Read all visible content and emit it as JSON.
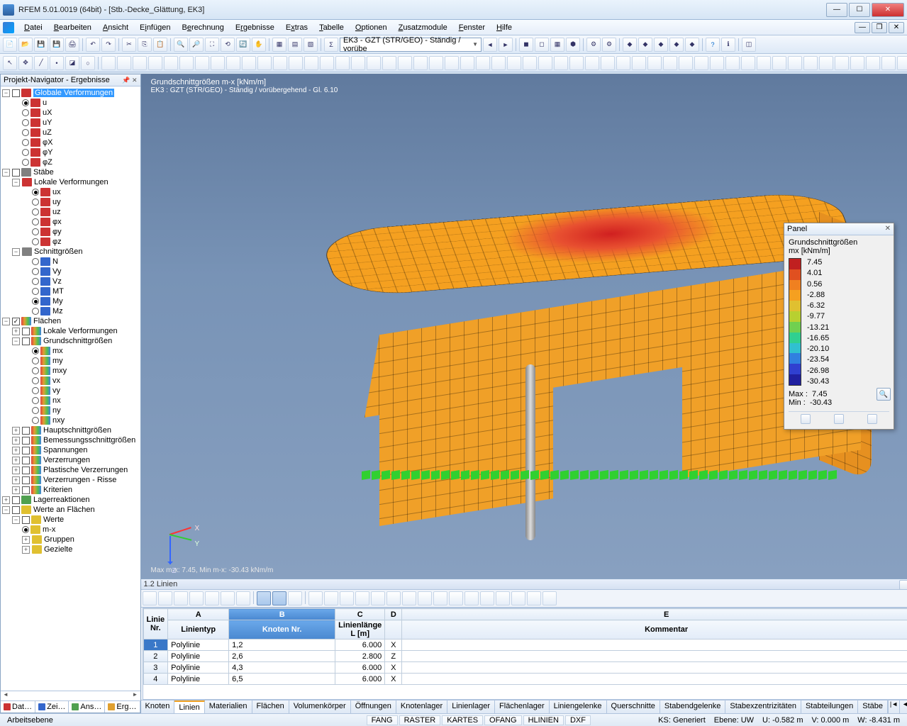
{
  "window": {
    "title": "RFEM 5.01.0019 (64bit) - [Stb.-Decke_Glättung, EK3]"
  },
  "menu": [
    "Datei",
    "Bearbeiten",
    "Ansicht",
    "Einfügen",
    "Berechnung",
    "Ergebnisse",
    "Extras",
    "Tabelle",
    "Optionen",
    "Zusatzmodule",
    "Fenster",
    "Hilfe"
  ],
  "menu_keys": [
    "D",
    "B",
    "A",
    "i",
    "e",
    "r",
    "x",
    "T",
    "O",
    "Z",
    "F",
    "H"
  ],
  "loadcase_combo": "EK3 - GZT (STR/GEO) - Ständig / vorübe",
  "nav": {
    "title": "Projekt-Navigator - Ergebnisse",
    "globale": {
      "label": "Globale Verformungen",
      "items": [
        "u",
        "uX",
        "uY",
        "uZ",
        "φX",
        "φY",
        "φZ"
      ],
      "sel_index": 0
    },
    "staebe": {
      "label": "Stäbe",
      "lokale": {
        "label": "Lokale Verformungen",
        "items": [
          "ux",
          "uy",
          "uz",
          "φx",
          "φy",
          "φz"
        ],
        "sel_index": 0
      },
      "schnitt": {
        "label": "Schnittgrößen",
        "items": [
          "N",
          "Vy",
          "Vz",
          "MT",
          "My",
          "Mz"
        ],
        "sel_index": 4
      }
    },
    "flaechen": {
      "label": "Flächen",
      "lokale": "Lokale Verformungen",
      "grund": {
        "label": "Grundschnittgrößen",
        "items": [
          "mx",
          "my",
          "mxy",
          "vx",
          "vy",
          "nx",
          "ny",
          "nxy"
        ],
        "sel_index": 0
      },
      "rest": [
        "Hauptschnittgrößen",
        "Bemessungsschnittgrößen",
        "Spannungen",
        "Verzerrungen",
        "Plastische Verzerrungen",
        "Verzerrungen - Risse",
        "Kriterien"
      ]
    },
    "lager": "Lagerreaktionen",
    "werte": {
      "label": "Werte an Flächen",
      "sub_label": "Werte",
      "items": [
        "m-x",
        "Gruppen",
        "Gezielte"
      ],
      "sel_index": 0
    },
    "tabs": [
      "Dat…",
      "Zei…",
      "Ans…",
      "Erg…"
    ]
  },
  "viewport": {
    "title": "Grundschnittgrößen m-x [kNm/m]",
    "subtitle": "EK3 : GZT (STR/GEO) - Ständig / vorübergehend - Gl. 6.10",
    "footer": "Max m-x: 7.45, Min m-x: -30.43 kNm/m",
    "axes": {
      "x": "X",
      "y": "Y",
      "z": "Z"
    }
  },
  "legend": {
    "title": "Panel",
    "heading": "Grundschnittgrößen",
    "unit": "mx [kNm/m]",
    "values": [
      "7.45",
      "4.01",
      "0.56",
      "-2.88",
      "-6.32",
      "-9.77",
      "-13.21",
      "-16.65",
      "-20.10",
      "-23.54",
      "-26.98",
      "-30.43"
    ],
    "colors": [
      "#c02020",
      "#e05020",
      "#f08020",
      "#f5a020",
      "#e0c030",
      "#b8d030",
      "#70d050",
      "#30d090",
      "#30c0d0",
      "#3080e0",
      "#3040d0",
      "#2020a0"
    ],
    "max_label": "Max :",
    "max_val": "7.45",
    "min_label": "Min :",
    "min_val": "-30.43"
  },
  "data": {
    "section_title": "1.2 Linien",
    "col_letters": [
      "A",
      "B",
      "C",
      "D",
      "E"
    ],
    "headers": {
      "row": "Linie\nNr.",
      "a": "Linientyp",
      "b": "Knoten Nr.",
      "c1": "Linienlänge",
      "c2": "L [m]",
      "d": "",
      "e": "Kommentar"
    },
    "rows": [
      {
        "n": "1",
        "a": "Polylinie",
        "b": "1,2",
        "c": "6.000",
        "d": "X"
      },
      {
        "n": "2",
        "a": "Polylinie",
        "b": "2,6",
        "c": "2.800",
        "d": "Z"
      },
      {
        "n": "3",
        "a": "Polylinie",
        "b": "4,3",
        "c": "6.000",
        "d": "X"
      },
      {
        "n": "4",
        "a": "Polylinie",
        "b": "6,5",
        "c": "6.000",
        "d": "X"
      }
    ],
    "tabs": [
      "Knoten",
      "Linien",
      "Materialien",
      "Flächen",
      "Volumenkörper",
      "Öffnungen",
      "Knotenlager",
      "Linienlager",
      "Flächenlager",
      "Liniengelenke",
      "Querschnitte",
      "Stabendgelenke",
      "Stabexzentrizitäten",
      "Stabteilungen",
      "Stäbe"
    ],
    "active_tab": 1
  },
  "status": {
    "left": "Arbeitsebene",
    "toggles": [
      "FANG",
      "RASTER",
      "KARTES",
      "OFANG",
      "HLINIEN",
      "DXF"
    ],
    "ks": "KS: Generiert",
    "ebene": "Ebene: UW",
    "u": "U:   -0.582 m",
    "v": "V:   0.000 m",
    "w": "W:   -8.431 m"
  }
}
